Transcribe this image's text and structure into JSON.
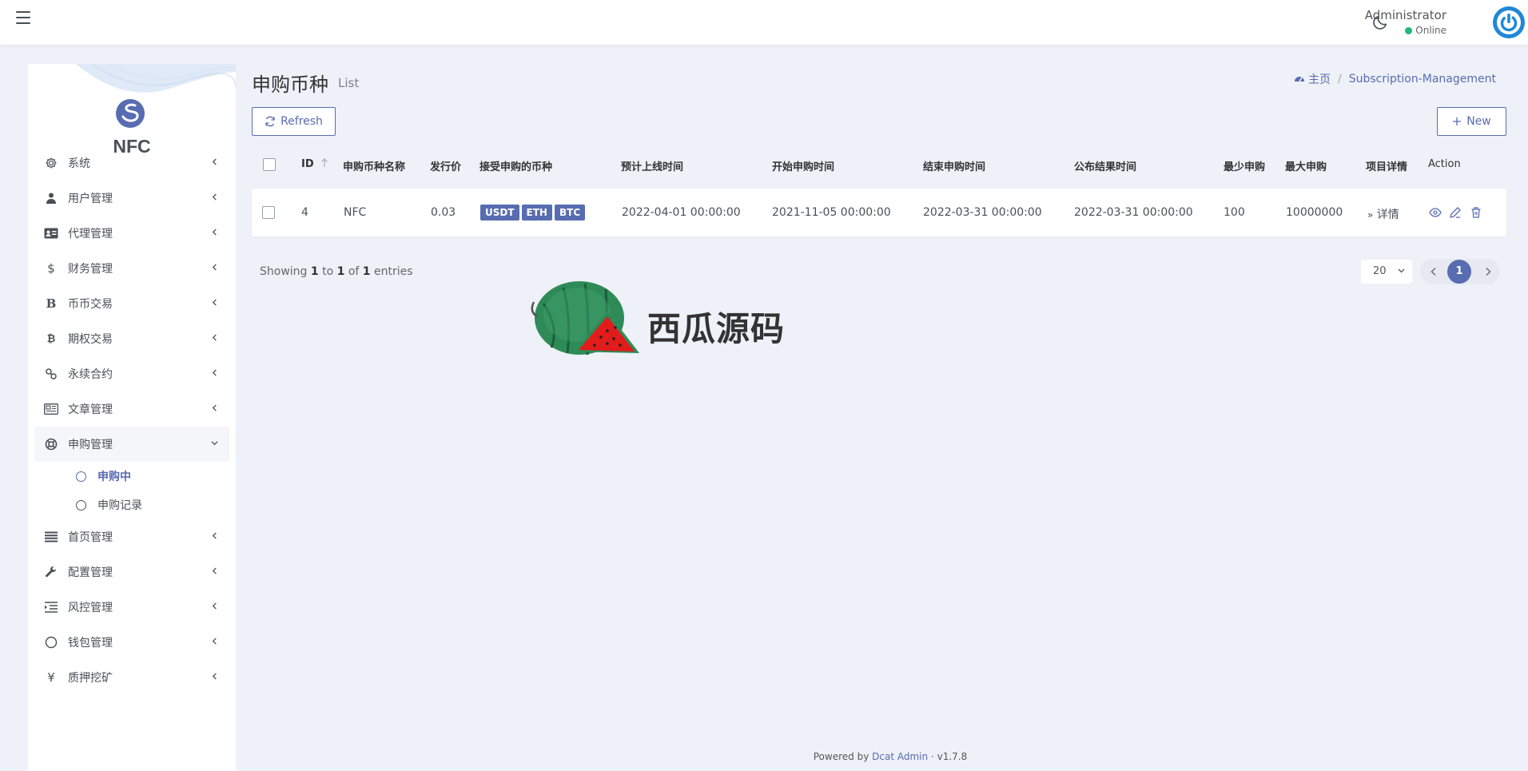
{
  "topbar": {
    "user_name": "Administrator",
    "user_status": "Online"
  },
  "colors": {
    "primary": "#586cb1",
    "online": "#21b978",
    "background": "#eef1f7"
  },
  "brand": {
    "name": "NFC"
  },
  "sidebar": {
    "items": [
      {
        "label": "系统",
        "icon": "gear-icon"
      },
      {
        "label": "用户管理",
        "icon": "users-icon"
      },
      {
        "label": "代理管理",
        "icon": "id-card-icon"
      },
      {
        "label": "财务管理",
        "icon": "dollar-icon"
      },
      {
        "label": "币币交易",
        "icon": "bitcoin-b-icon"
      },
      {
        "label": "期权交易",
        "icon": "bitcoin-icon"
      },
      {
        "label": "永续合约",
        "icon": "link-icon"
      },
      {
        "label": "文章管理",
        "icon": "newspaper-icon"
      },
      {
        "label": "申购管理",
        "icon": "lifebuoy-icon"
      },
      {
        "label": "首页管理",
        "icon": "list-icon"
      },
      {
        "label": "配置管理",
        "icon": "wrench-icon"
      },
      {
        "label": "风控管理",
        "icon": "indent-icon"
      },
      {
        "label": "钱包管理",
        "icon": "circle-icon"
      },
      {
        "label": "质押挖矿",
        "icon": "yen-icon"
      }
    ],
    "sub_items": [
      {
        "label": "申购中"
      },
      {
        "label": "申购记录"
      }
    ]
  },
  "page": {
    "title": "申购币种",
    "subtitle": "List",
    "breadcrumb_home": "主页",
    "breadcrumb_current": "Subscription-Management",
    "refresh_label": "Refresh",
    "new_label": "New"
  },
  "table": {
    "headers": [
      "ID",
      "申购币种名称",
      "发行价",
      "接受申购的币种",
      "预计上线时间",
      "开始申购时间",
      "结束申购时间",
      "公布结果时间",
      "最少申购",
      "最大申购",
      "项目详情",
      "Action"
    ],
    "rows": [
      {
        "id": "4",
        "name": "NFC",
        "price": "0.03",
        "coins": [
          "USDT",
          "ETH",
          "BTC"
        ],
        "online_time": "2022-04-01 00:00:00",
        "start_time": "2021-11-05 00:00:00",
        "end_time": "2022-03-31 00:00:00",
        "result_time": "2022-03-31 00:00:00",
        "min": "100",
        "max": "10000000",
        "detail": "详情"
      }
    ]
  },
  "pagination": {
    "showing_prefix": "Showing",
    "from": "1",
    "to_word": "to",
    "to": "1",
    "of_word": "of",
    "total": "1",
    "entries_word": "entries",
    "per_page": "20",
    "current_page": "1"
  },
  "watermark": {
    "text": "西瓜源码"
  },
  "footer": {
    "powered_by": "Powered by",
    "brand": "Dcat Admin",
    "separator": "·",
    "version": "v1.7.8"
  }
}
